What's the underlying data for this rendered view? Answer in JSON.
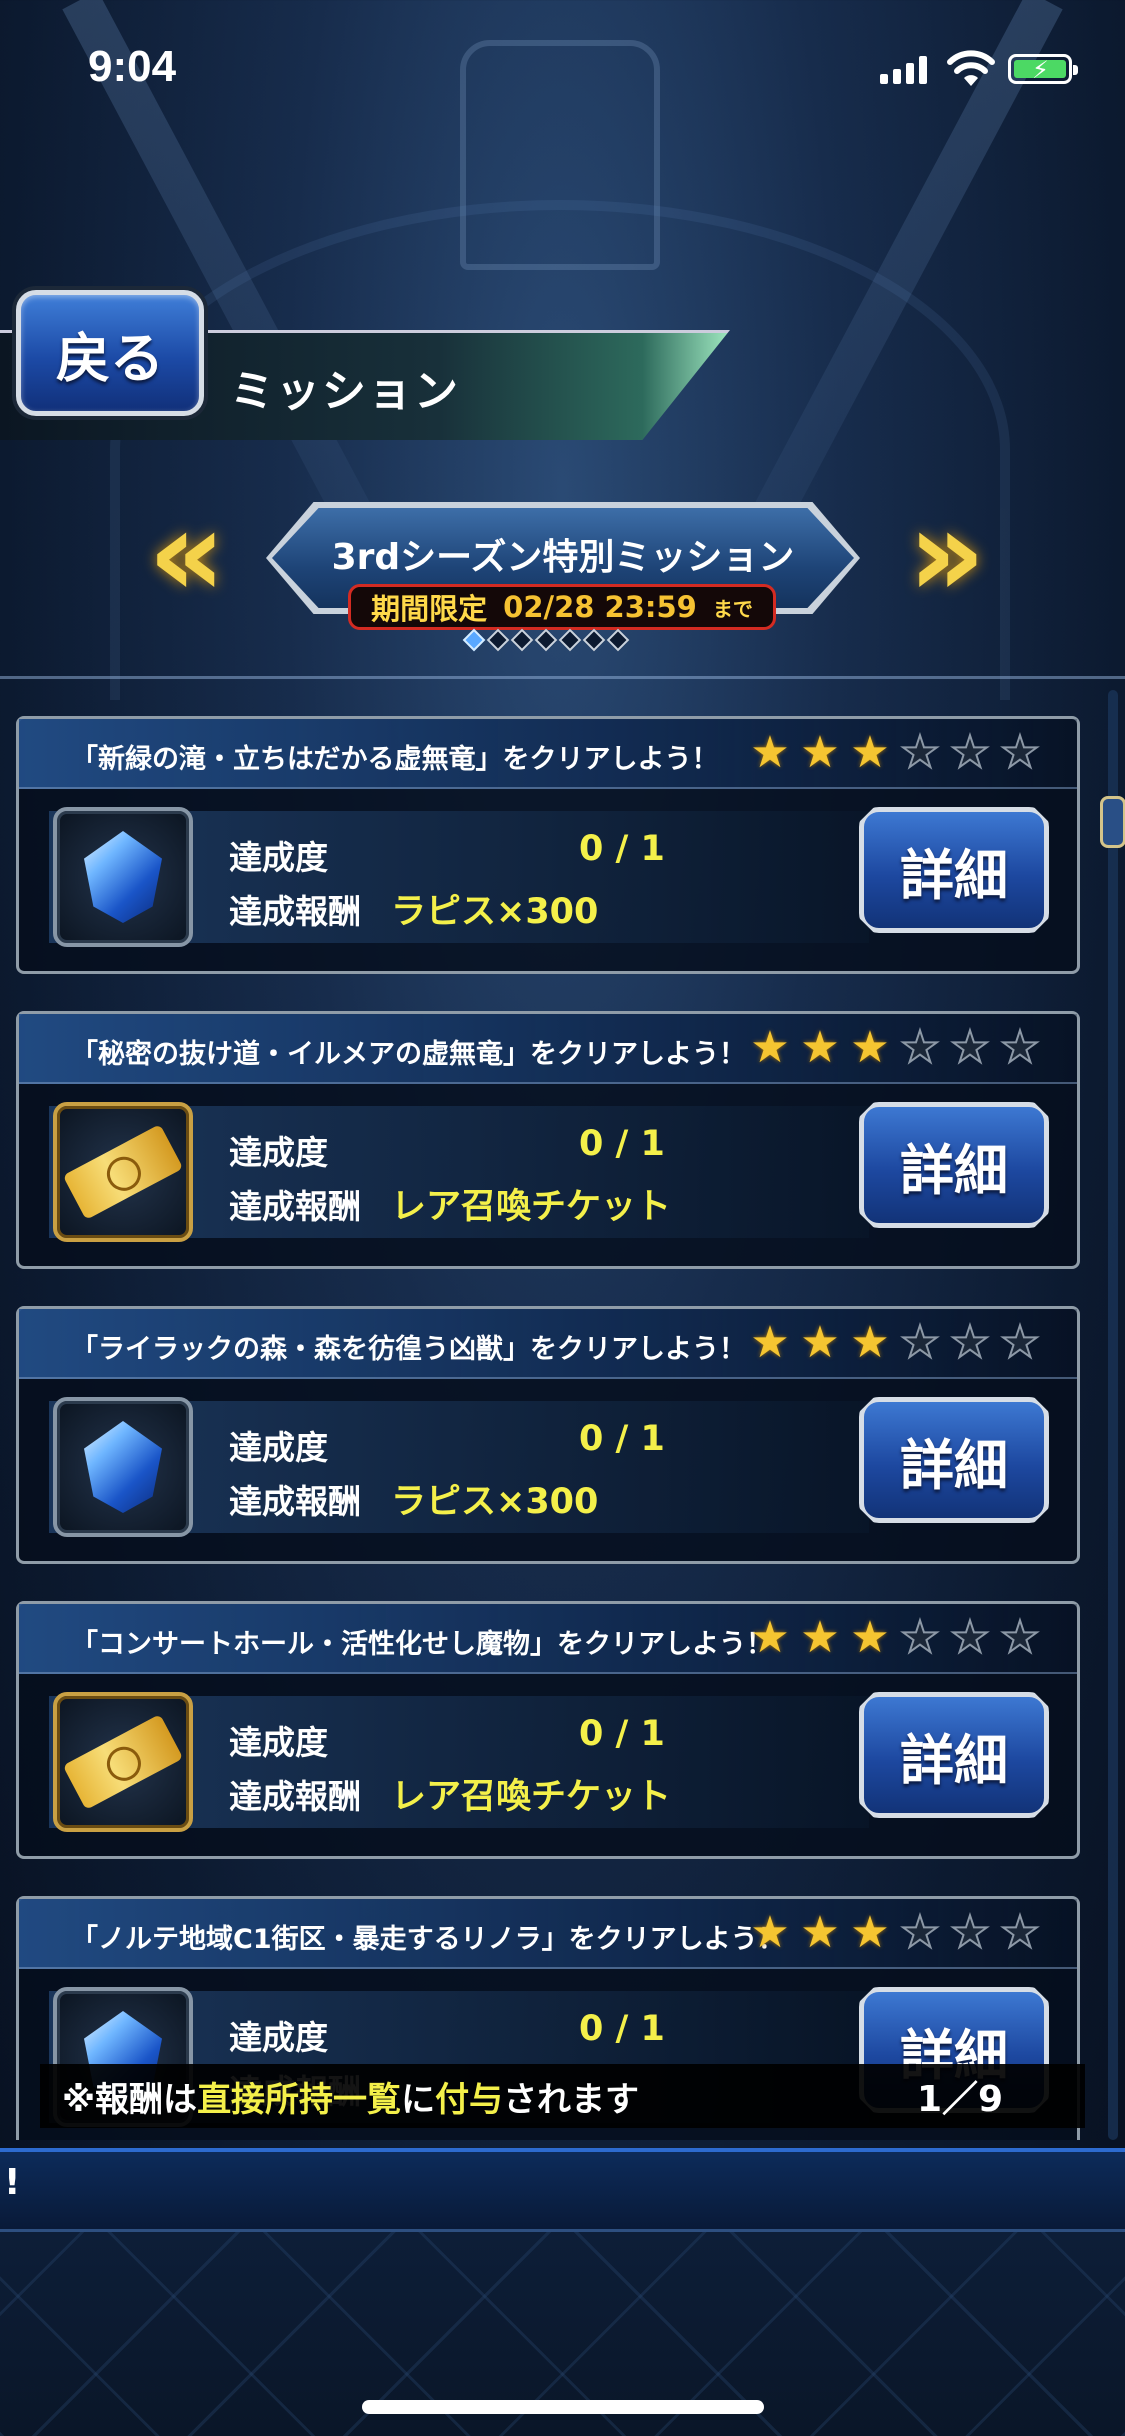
{
  "status_bar": {
    "time": "9:04"
  },
  "header": {
    "back_label": "戻る",
    "title": "ミッション"
  },
  "event": {
    "title": "3rdシーズン特別ミッション",
    "limited_label": "期間限定",
    "deadline": "02/28 23:59",
    "deadline_suffix": "まで",
    "page_count": 7,
    "active_page": 1
  },
  "labels": {
    "progress": "達成度",
    "reward": "達成報酬",
    "detail": "詳細"
  },
  "missions": [
    {
      "name": "「新緑の滝・立ちはだかる虚無竜」をクリアしよう！",
      "stars": 3,
      "max_stars": 6,
      "progress": "0 / 1",
      "reward": "ラピス×300",
      "reward_icon": "lapis-gem-icon"
    },
    {
      "name": "「秘密の抜け道・イルメアの虚無竜」をクリアしよう！",
      "stars": 3,
      "max_stars": 6,
      "progress": "0 / 1",
      "reward": "レア召喚チケット",
      "reward_icon": "summon-ticket-icon"
    },
    {
      "name": "「ライラックの森・森を彷徨う凶獣」をクリアしよう！",
      "stars": 3,
      "max_stars": 6,
      "progress": "0 / 1",
      "reward": "ラピス×300",
      "reward_icon": "lapis-gem-icon"
    },
    {
      "name": "「コンサートホール・活性化せし魔物」をクリアしよう！",
      "stars": 3,
      "max_stars": 6,
      "progress": "0 / 1",
      "reward": "レア召喚チケット",
      "reward_icon": "summon-ticket-icon"
    },
    {
      "name": "「ノルテ地域C1街区・暴走するリノラ」をクリアしよう！",
      "stars": 3,
      "max_stars": 6,
      "progress": "0 / 1",
      "reward": "",
      "reward_icon": "lapis-gem-icon"
    }
  ],
  "notice": {
    "prefix": "※報酬は",
    "highlight1": "直接所持一覧",
    "middle": "に",
    "highlight2": "付与",
    "suffix": "されます"
  },
  "pagination": "1／9",
  "ticker": "!",
  "colors": {
    "accent_yellow": "#f4f04a",
    "star_gold": "#f5c531",
    "button_blue": "#1d48a0",
    "limited_red": "#d32b22"
  }
}
